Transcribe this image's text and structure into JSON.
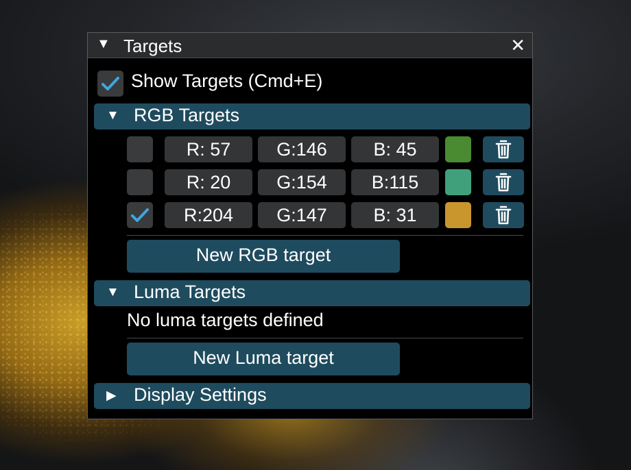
{
  "panel": {
    "title": "Targets",
    "collapse_glyph": "▼",
    "close_glyph": "✕",
    "show_targets": {
      "label": "Show Targets (Cmd+E)",
      "checked": true
    },
    "rgb_section": {
      "title": "RGB Targets",
      "glyph": "▼",
      "rows": [
        {
          "checked": false,
          "r": "R: 57",
          "g": "G:146",
          "b": "B: 45",
          "swatch": "#4a8b32"
        },
        {
          "checked": false,
          "r": "R: 20",
          "g": "G:154",
          "b": "B:115",
          "swatch": "#40a07c"
        },
        {
          "checked": true,
          "r": "R:204",
          "g": "G:147",
          "b": "B: 31",
          "swatch": "#c9962e"
        }
      ],
      "new_button": "New RGB target"
    },
    "luma_section": {
      "title": "Luma Targets",
      "glyph": "▼",
      "empty_text": "No luma targets defined",
      "new_button": "New Luma target"
    },
    "display_section": {
      "title": "Display Settings",
      "glyph": "▶"
    }
  },
  "colors": {
    "accent": "#1f4b5e",
    "check_mark": "#3ea7e0",
    "panel_bg": "#000000"
  },
  "icons": {
    "trash": "trash-icon",
    "check": "checkmark-icon",
    "close": "close-icon"
  }
}
